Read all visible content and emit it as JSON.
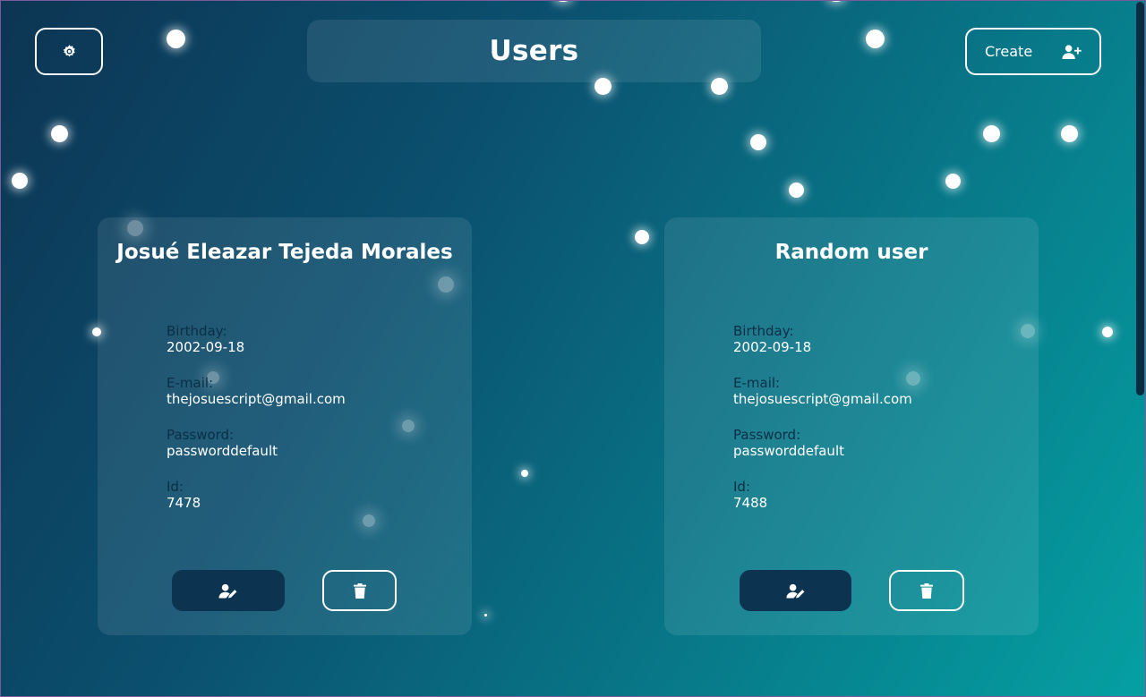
{
  "header": {
    "title": "Users",
    "create_label": "Create"
  },
  "users": [
    {
      "name": "Josué Eleazar Tejeda Morales",
      "fields": [
        {
          "label": "Birthday:",
          "value": "2002-09-18"
        },
        {
          "label": "E-mail:",
          "value": "thejosuescript@gmail.com"
        },
        {
          "label": "Password:",
          "value": "passworddefault"
        },
        {
          "label": "Id:",
          "value": "7478"
        }
      ]
    },
    {
      "name": "Random user",
      "fields": [
        {
          "label": "Birthday:",
          "value": "2002-09-18"
        },
        {
          "label": "E-mail:",
          "value": "thejosuescript@gmail.com"
        },
        {
          "label": "Password:",
          "value": "passworddefault"
        },
        {
          "label": "Id:",
          "value": "7488"
        }
      ]
    }
  ],
  "icons": {
    "settings": "gear-icon",
    "create": "user-plus-icon",
    "edit": "user-edit-icon",
    "delete": "trash-icon"
  },
  "colors": {
    "background_start": "#0c3553",
    "background_end": "#05a0a3",
    "edit_button": "#0c3450",
    "field_label": "#0a2f47"
  }
}
